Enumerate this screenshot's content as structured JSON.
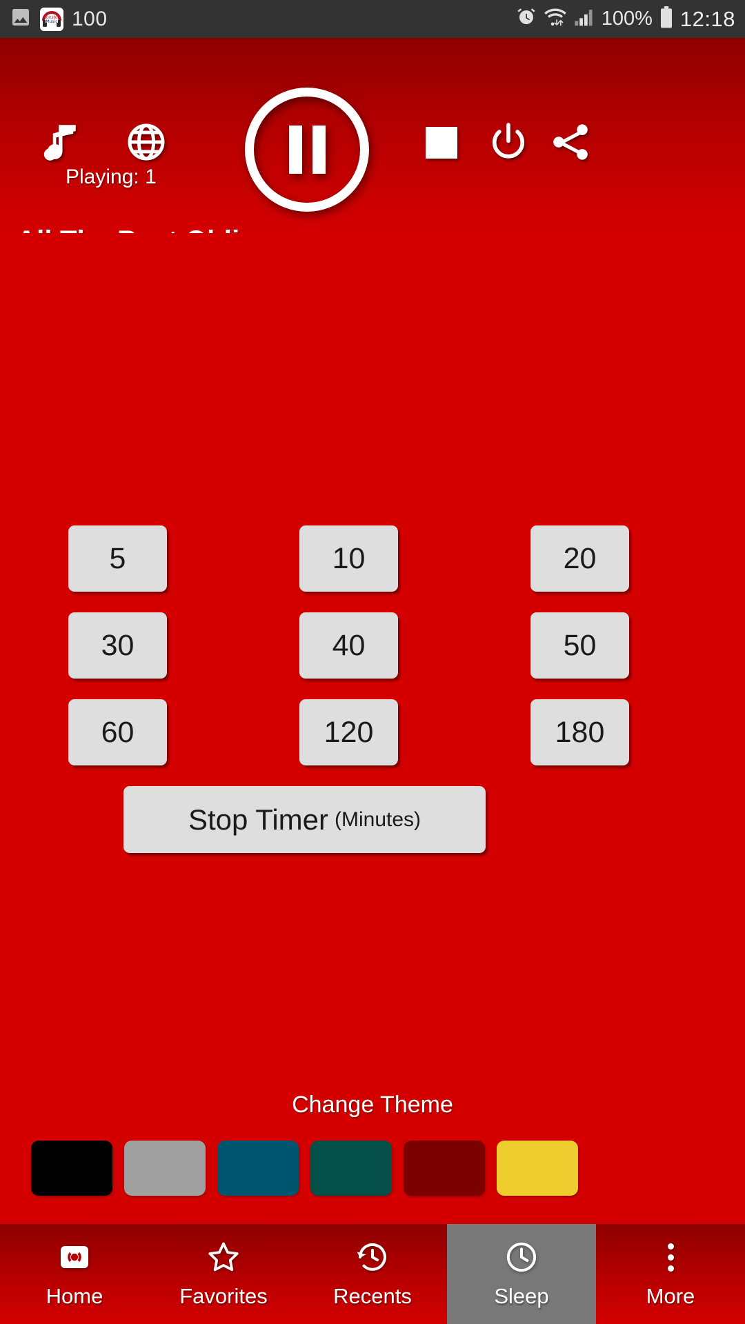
{
  "status_bar": {
    "left_icons": [
      "image-icon",
      "nonstop-music-app-icon"
    ],
    "notification_count": "100",
    "right_icons": [
      "alarm-icon",
      "wifi-icon",
      "signal-icon",
      "battery-icon"
    ],
    "battery_percent": "100%",
    "time": "12:18",
    "background": "#333333"
  },
  "header": {
    "background_top": "#8d0000",
    "background_bottom": "#d40000",
    "music_icon": "music-note-icon",
    "globe_icon": "globe-icon",
    "play_state_icon": "pause-icon",
    "stop_icon": "stop-square-icon",
    "power_icon": "power-icon",
    "share_icon": "share-icon",
    "playing_label": "Playing: 1",
    "station_title": "All The Best Oldies"
  },
  "sleep_timer": {
    "options": [
      "5",
      "10",
      "20",
      "30",
      "40",
      "50",
      "60",
      "120",
      "180"
    ],
    "stop_button": {
      "main_label": "Stop Timer",
      "sub_label": "(Minutes)"
    },
    "button_color": "#dedede",
    "text_color": "#1a1a1a"
  },
  "theme": {
    "label": "Change Theme",
    "swatches": [
      {
        "name": "black",
        "color": "#000000"
      },
      {
        "name": "gray",
        "color": "#a0a0a0"
      },
      {
        "name": "teal-blue",
        "color": "#00566e"
      },
      {
        "name": "dark-green",
        "color": "#044f47"
      },
      {
        "name": "dark-red",
        "color": "#7d0000"
      },
      {
        "name": "yellow",
        "color": "#f0cd2e"
      }
    ]
  },
  "bottom_nav": {
    "active_index": 3,
    "active_background": "#787878",
    "items": [
      {
        "label": "Home",
        "icon": "broadcast-icon"
      },
      {
        "label": "Favorites",
        "icon": "star-icon"
      },
      {
        "label": "Recents",
        "icon": "history-icon"
      },
      {
        "label": "Sleep",
        "icon": "clock-icon"
      },
      {
        "label": "More",
        "icon": "overflow-menu-icon"
      }
    ]
  },
  "app_background": "#d40000"
}
